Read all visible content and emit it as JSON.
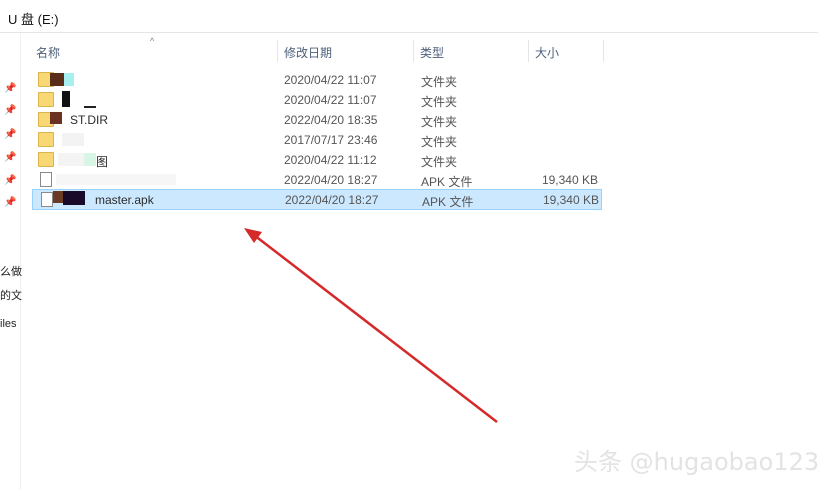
{
  "window": {
    "title": "U 盘 (E:)"
  },
  "nav_pane": {
    "labels": [
      "么做",
      "的文",
      "iles"
    ]
  },
  "columns": {
    "name": "名称",
    "date": "修改日期",
    "type": "类型",
    "size": "大小"
  },
  "files": [
    {
      "name": "",
      "date": "2020/04/22 11:07",
      "type": "文件夹",
      "size": "",
      "icon": "folder-icon"
    },
    {
      "name": "",
      "date": "2020/04/22 11:07",
      "type": "文件夹",
      "size": "",
      "icon": "folder-icon"
    },
    {
      "name": "ST.DIR",
      "date": "2022/04/20 18:35",
      "type": "文件夹",
      "size": "",
      "icon": "folder-icon"
    },
    {
      "name": "",
      "date": "2017/07/17 23:46",
      "type": "文件夹",
      "size": "",
      "icon": "folder-icon"
    },
    {
      "name": "图",
      "date": "2020/04/22 11:12",
      "type": "文件夹",
      "size": "",
      "icon": "folder-icon"
    },
    {
      "name": "",
      "date": "2022/04/20 18:27",
      "type": "APK 文件",
      "size": "19,340 KB",
      "icon": "file-icon"
    },
    {
      "name": "master.apk",
      "date": "2022/04/20 18:27",
      "type": "APK 文件",
      "size": "19,340 KB",
      "icon": "file-icon",
      "selected": true
    }
  ],
  "colors": {
    "selection_bg": "#cce8ff",
    "selection_border": "#99d1ff",
    "arrow": "#d42a2a",
    "header_text": "#4c607a"
  },
  "watermark": "头条 @hugaobao123"
}
